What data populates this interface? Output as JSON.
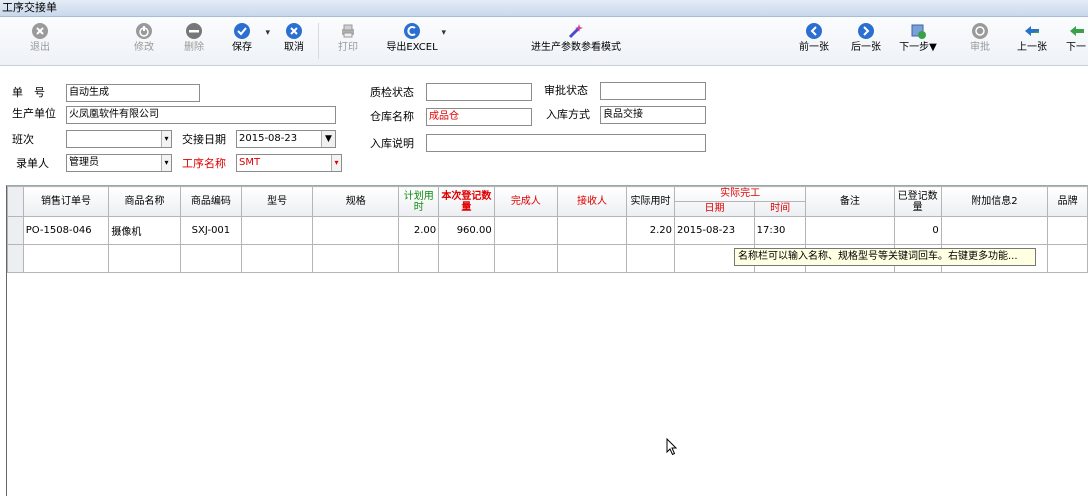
{
  "window": {
    "title": "工序交接单"
  },
  "toolbar": {
    "exit": "退出",
    "edit": "修改",
    "delete": "删除",
    "save": "保存",
    "cancel": "取消",
    "print": "打印",
    "export_excel": "导出EXCEL",
    "param_mode": "进生产参数参看模式",
    "prev_sheet": "前一张",
    "next_sheet": "后一张",
    "next_step": "下一步▼",
    "approve": "审批",
    "prev_one": "上一张",
    "next_one": "下一"
  },
  "form": {
    "order_no_label": "单　号",
    "order_no_value": "自动生成",
    "prod_unit_label": "生产单位",
    "prod_unit_value": "火凤凰软件有限公司",
    "shift_label": "班次",
    "shift_value": "",
    "handover_date_label": "交接日期",
    "handover_date_value": "2015-08-23",
    "entered_by_label": "录单人",
    "entered_by_value": "管理员",
    "process_name_label": "工序名称",
    "process_name_value": "SMT",
    "qc_status_label": "质检状态",
    "qc_status_value": "",
    "warehouse_label": "仓库名称",
    "warehouse_value": "成品仓",
    "inbound_note_label": "入库说明",
    "inbound_note_value": "",
    "approval_status_label": "审批状态",
    "approval_status_value": "",
    "inbound_method_label": "入库方式",
    "inbound_method_value": "良品交接"
  },
  "grid": {
    "headers": {
      "sales_order": "销售订单号",
      "product_name": "商品名称",
      "product_code": "商品编码",
      "model": "型号",
      "spec": "规格",
      "planned_time": "计划用时",
      "this_qty": "本次登记数量",
      "finisher": "完成人",
      "receiver": "接收人",
      "actual_time": "实际用时",
      "actual_finish": "实际完工",
      "date": "日期",
      "time": "时间",
      "remark": "备注",
      "registered_qty": "已登记数量",
      "extra_info2": "附加信息2",
      "brand": "品牌"
    },
    "rows": [
      {
        "sales_order": "PO-1508-046",
        "product_name": "摄像机",
        "product_code": "SXJ-001",
        "model": "",
        "spec": "",
        "planned_time": "2.00",
        "this_qty": "960.00",
        "finisher": "",
        "receiver": "",
        "actual_time": "2.20",
        "date": "2015-08-23",
        "time": "17:30",
        "remark": "",
        "registered_qty": "0",
        "extra_info2": "",
        "brand": ""
      }
    ]
  },
  "tooltip": {
    "text": "名称栏可以输入名称、规格型号等关键词回车。右键更多功能..."
  },
  "colors": {
    "accent_red": "#e00000",
    "accent_green": "#0a8a0a",
    "tooltip_bg": "#ffffe1"
  }
}
